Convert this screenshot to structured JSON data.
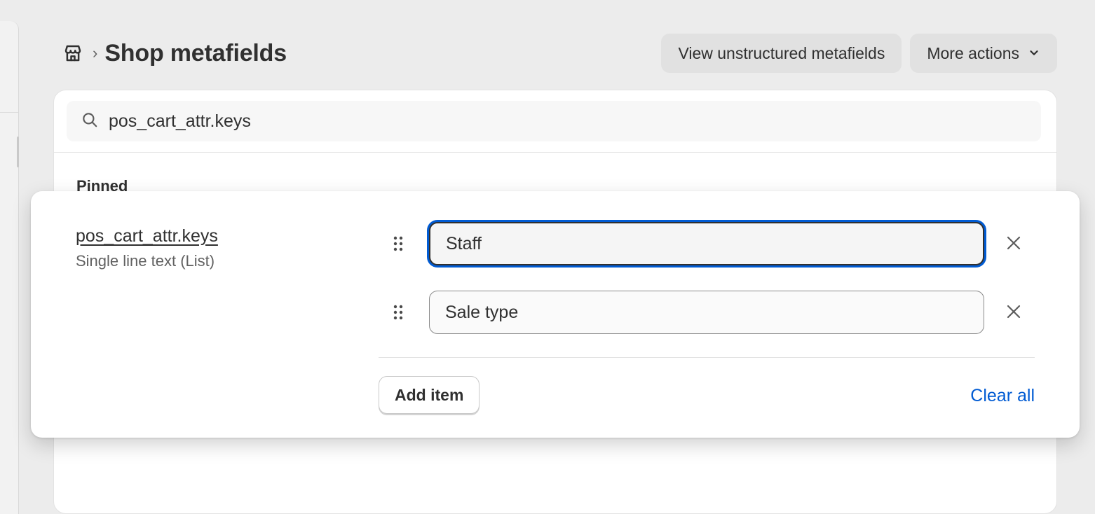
{
  "header": {
    "title": "Shop metafields",
    "breadcrumb_separator": "›",
    "breadcrumb_icon": "store-icon"
  },
  "actions": {
    "view_unstructured_label": "View unstructured metafields",
    "more_actions_label": "More actions"
  },
  "search": {
    "value": "pos_cart_attr.keys",
    "icon": "search-icon"
  },
  "pinned": {
    "section_label": "Pinned"
  },
  "metafield": {
    "name": "pos_cart_attr.keys",
    "type": "Single line text (List)",
    "items": [
      {
        "value": "Staff",
        "focused": true
      },
      {
        "value": "Sale type",
        "focused": false
      }
    ],
    "add_item_label": "Add item",
    "clear_all_label": "Clear all"
  },
  "colors": {
    "focus_ring": "#005bd3",
    "link": "#005bd3",
    "background": "#ececec",
    "secondary_button": "#e1e1e1"
  }
}
